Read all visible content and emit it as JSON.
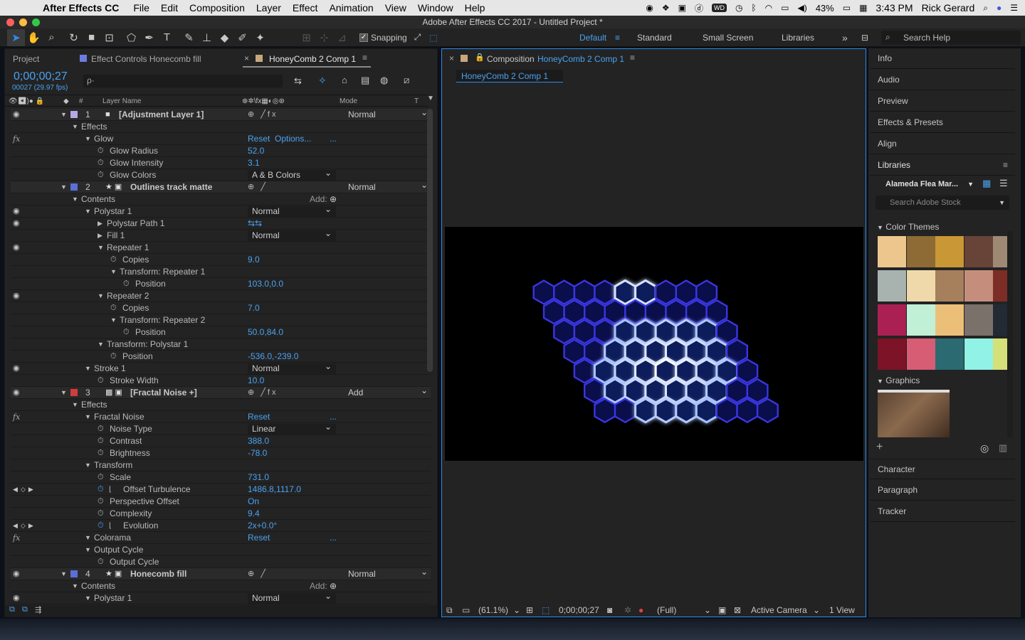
{
  "menubar": {
    "app": "After Effects CC",
    "items": [
      "File",
      "Edit",
      "Composition",
      "Layer",
      "Effect",
      "Animation",
      "View",
      "Window",
      "Help"
    ],
    "battery": "43%",
    "time": "3:43 PM",
    "user": "Rick Gerard"
  },
  "window": {
    "title": "Adobe After Effects CC 2017 - Untitled Project *"
  },
  "toolbar": {
    "snapping": "Snapping",
    "workspaces": [
      "Default",
      "Standard",
      "Small Screen",
      "Libraries"
    ],
    "more": "»",
    "search": "Search Help"
  },
  "project_panel": {
    "tab_project": "Project",
    "tab_effect_controls": "Effect Controls Honecomb fill",
    "tab_timeline": "HoneyComb 2 Comp 1",
    "timecode": "0;00;00;27",
    "frames": "00027 (29.97 fps)",
    "search_placeholder": "ρ·",
    "col_layer_name": "Layer Name",
    "col_mode": "Mode",
    "col_t": "T",
    "col_num": "#"
  },
  "layers": [
    {
      "t": "layer",
      "num": "1",
      "name": "[Adjustment Layer 1]",
      "mode": "Normal",
      "color": "#b9a6e8",
      "icon": "square",
      "eye": true
    },
    {
      "t": "group",
      "name": "Effects",
      "indent": 1
    },
    {
      "t": "fx",
      "name": "Glow",
      "indent": 2,
      "reset": "Reset",
      "options": "Options...",
      "dots": "..."
    },
    {
      "t": "prop",
      "name": "Glow Radius",
      "indent": 3,
      "value": "52.0"
    },
    {
      "t": "prop",
      "name": "Glow Intensity",
      "indent": 3,
      "value": "3.1"
    },
    {
      "t": "propdd",
      "name": "Glow Colors",
      "indent": 3,
      "value": "A & B Colors"
    },
    {
      "t": "layer",
      "num": "2",
      "name": "Outlines track matte",
      "mode": "Normal",
      "color": "#5b6fd6",
      "icon": "star"
    },
    {
      "t": "group",
      "name": "Contents",
      "indent": 1,
      "add": "Add:"
    },
    {
      "t": "groupdd",
      "name": "Polystar 1",
      "indent": 2,
      "value": "Normal",
      "eye": true
    },
    {
      "t": "closed",
      "name": "Polystar Path 1",
      "indent": 3,
      "switches": "⇆⇆",
      "eye": true
    },
    {
      "t": "closeddd",
      "name": "Fill 1",
      "indent": 3,
      "value": "Normal"
    },
    {
      "t": "group",
      "name": "Repeater 1",
      "indent": 3,
      "eye": true
    },
    {
      "t": "prop",
      "name": "Copies",
      "indent": 4,
      "value": "9.0"
    },
    {
      "t": "group",
      "name": "Transform: Repeater 1",
      "indent": 4
    },
    {
      "t": "prop",
      "name": "Position",
      "indent": 5,
      "value": "103.0,0.0"
    },
    {
      "t": "group",
      "name": "Repeater 2",
      "indent": 3,
      "eye": true
    },
    {
      "t": "prop",
      "name": "Copies",
      "indent": 4,
      "value": "7.0"
    },
    {
      "t": "group",
      "name": "Transform: Repeater 2",
      "indent": 4
    },
    {
      "t": "prop",
      "name": "Position",
      "indent": 5,
      "value": "50.0,84.0"
    },
    {
      "t": "group",
      "name": "Transform: Polystar 1",
      "indent": 3
    },
    {
      "t": "prop",
      "name": "Position",
      "indent": 4,
      "value": "-536.0,-239.0"
    },
    {
      "t": "groupdd",
      "name": "Stroke 1",
      "indent": 2,
      "value": "Normal",
      "eye": true
    },
    {
      "t": "prop",
      "name": "Stroke Width",
      "indent": 3,
      "value": "10.0"
    },
    {
      "t": "layer",
      "num": "3",
      "name": "[Fractal Noise +]",
      "mode": "Add",
      "color": "#d23c3c",
      "icon": "solid",
      "eye": true
    },
    {
      "t": "group",
      "name": "Effects",
      "indent": 1
    },
    {
      "t": "fx",
      "name": "Fractal Noise",
      "indent": 2,
      "reset": "Reset",
      "dots": "..."
    },
    {
      "t": "propdd",
      "name": "Noise Type",
      "indent": 3,
      "value": "Linear"
    },
    {
      "t": "prop",
      "name": "Contrast",
      "indent": 3,
      "value": "388.0"
    },
    {
      "t": "prop",
      "name": "Brightness",
      "indent": 3,
      "value": "-78.0"
    },
    {
      "t": "group",
      "name": "Transform",
      "indent": 2
    },
    {
      "t": "prop",
      "name": "Scale",
      "indent": 3,
      "value": "731.0"
    },
    {
      "t": "propkf",
      "name": "Offset Turbulence",
      "indent": 3,
      "value": "1486.8,1117.0"
    },
    {
      "t": "prop",
      "name": "Perspective Offset",
      "indent": 3,
      "value": "On"
    },
    {
      "t": "prop",
      "name": "Complexity",
      "indent": 3,
      "value": "9.4"
    },
    {
      "t": "propkf",
      "name": "Evolution",
      "indent": 3,
      "value": "2x+0.0°"
    },
    {
      "t": "fx",
      "name": "Colorama",
      "indent": 2,
      "reset": "Reset",
      "dots": "..."
    },
    {
      "t": "group",
      "name": "Output Cycle",
      "indent": 2
    },
    {
      "t": "prop",
      "name": "Output Cycle",
      "indent": 3,
      "value": ""
    },
    {
      "t": "layer",
      "num": "4",
      "name": "Honecomb fill",
      "mode": "Normal",
      "color": "#5b6fd6",
      "icon": "star",
      "eye": true
    },
    {
      "t": "group",
      "name": "Contents",
      "indent": 1,
      "add": "Add:"
    },
    {
      "t": "groupdd",
      "name": "Polystar 1",
      "indent": 2,
      "value": "Normal",
      "eye": true
    }
  ],
  "composition": {
    "tab_label": "Composition",
    "comp_name": "HoneyComb 2 Comp 1",
    "sub_tab": "HoneyComb 2 Comp 1",
    "zoom": "(61.1%)",
    "timecode": "0;00;00;27",
    "resolution": "(Full)",
    "camera": "Active Camera",
    "view": "1 View"
  },
  "right_panel": {
    "items_top": [
      "Info",
      "Audio",
      "Preview",
      "Effects & Presets",
      "Align"
    ],
    "libraries": "Libraries",
    "library_name": "Alameda Flea Mar...",
    "stock_search": "Search Adobe Stock",
    "color_themes": "Color Themes",
    "graphics": "Graphics",
    "items_bottom": [
      "Character",
      "Paragraph",
      "Tracker"
    ],
    "themes": [
      [
        "#edc68e",
        "#8e6a34",
        "#c99735",
        "#674437",
        "#9e8a74"
      ],
      [
        "#a8b3b0",
        "#efd9ab",
        "#a67f5d",
        "#c58e7c",
        "#7c2e26"
      ],
      [
        "#ab2053",
        "#c1f0d7",
        "#ecbf78",
        "#7b716b",
        "#222a34"
      ],
      [
        "#7c1326",
        "#d65d74",
        "#2a6a70",
        "#91f2e6",
        "#d4e079"
      ]
    ]
  },
  "colors": {
    "accent": "#2d8ceb",
    "value_blue": "#4aa2f0",
    "panel": "#232323"
  }
}
